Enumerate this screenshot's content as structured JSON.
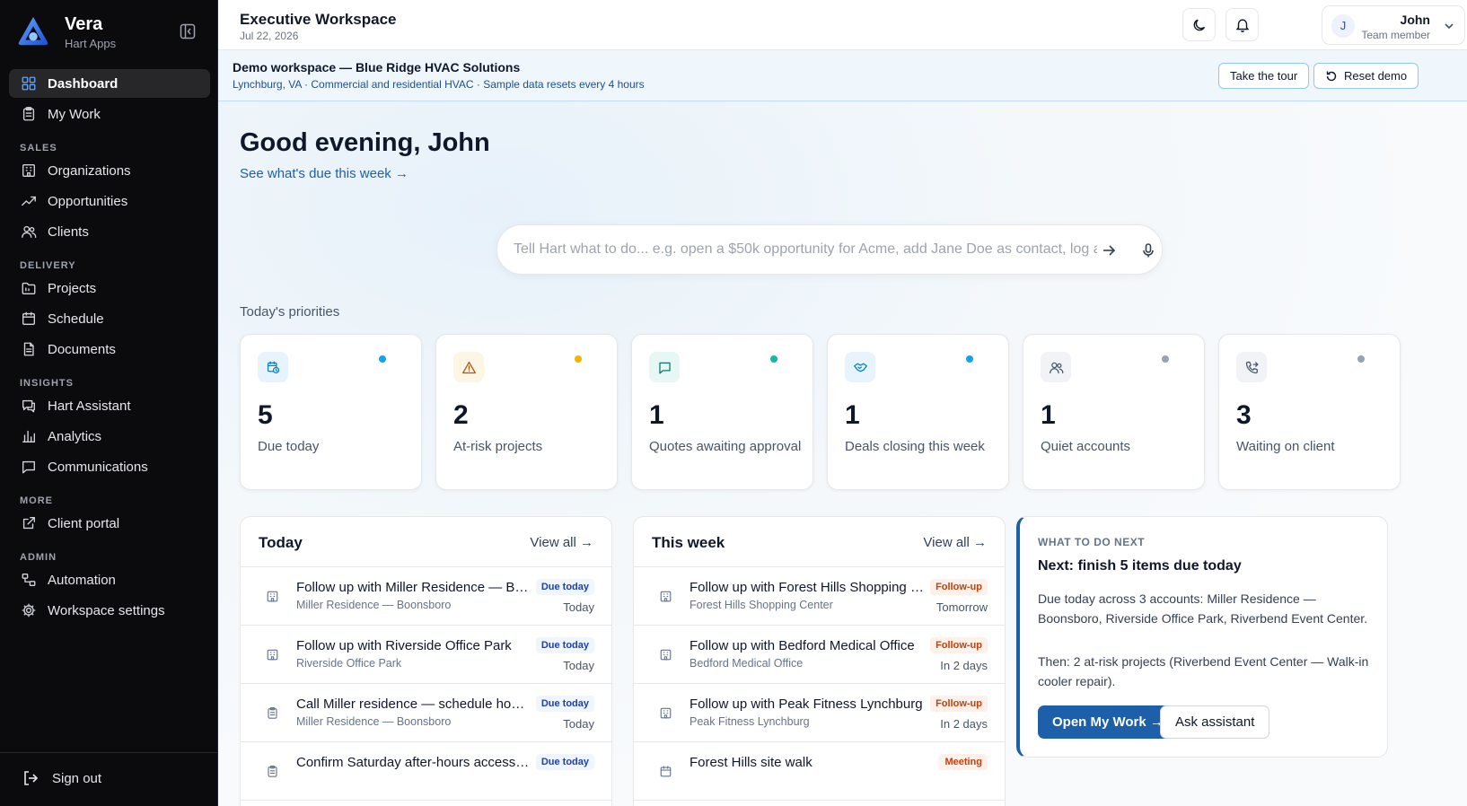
{
  "brand": {
    "name": "Vera",
    "sub": "Hart Apps"
  },
  "nav": {
    "items": [
      {
        "label": "Dashboard",
        "icon": "dashboard-icon",
        "active": true
      },
      {
        "label": "My Work",
        "icon": "clipboard-icon"
      }
    ],
    "sections": [
      {
        "title": "SALES",
        "items": [
          {
            "label": "Organizations",
            "icon": "building-icon"
          },
          {
            "label": "Opportunities",
            "icon": "trending-up-icon"
          },
          {
            "label": "Clients",
            "icon": "users-icon"
          }
        ]
      },
      {
        "title": "DELIVERY",
        "items": [
          {
            "label": "Projects",
            "icon": "folder-icon"
          },
          {
            "label": "Schedule",
            "icon": "calendar-icon"
          },
          {
            "label": "Documents",
            "icon": "document-icon"
          }
        ]
      },
      {
        "title": "INSIGHTS",
        "items": [
          {
            "label": "Hart Assistant",
            "icon": "chat-icon"
          },
          {
            "label": "Analytics",
            "icon": "bar-chart-icon"
          },
          {
            "label": "Communications",
            "icon": "message-icon"
          }
        ]
      },
      {
        "title": "MORE",
        "items": [
          {
            "label": "Client portal",
            "icon": "external-link-icon"
          }
        ]
      },
      {
        "title": "ADMIN",
        "items": [
          {
            "label": "Automation",
            "icon": "workflow-icon"
          },
          {
            "label": "Workspace settings",
            "icon": "gear-icon"
          }
        ]
      }
    ],
    "signout": "Sign out"
  },
  "header": {
    "title": "Executive Workspace",
    "date": "Jul 22, 2026",
    "user": {
      "initial": "J",
      "name": "John",
      "role": "Team member"
    }
  },
  "banner": {
    "title": "Demo workspace — Blue Ridge HVAC Solutions",
    "sub": "Lynchburg, VA · Commercial and residential HVAC · Sample data resets every 4 hours",
    "tour": "Take the tour",
    "reset": "Reset demo"
  },
  "main": {
    "greeting": "Good evening, John",
    "due_link": "See what's due this week →",
    "command_placeholder": "Tell Hart what to do... e.g. open a $50k opportunity for Acme, add Jane Doe as contact, log a call",
    "priorities_label": "Today's priorities",
    "cards": [
      {
        "num": "5",
        "label": "Due today",
        "icon": "calendar-clock-icon",
        "icon_bg": "#e8f4fd",
        "icon_color": "#0284c7",
        "dot": "#0ea5e9"
      },
      {
        "num": "2",
        "label": "At-risk projects",
        "icon": "warning-icon",
        "icon_bg": "#fef6e4",
        "icon_color": "#b45309",
        "dot": "#f5b301"
      },
      {
        "num": "1",
        "label": "Quotes awaiting approval",
        "icon": "message-square-icon",
        "icon_bg": "#e7f7f3",
        "icon_color": "#0f766e",
        "dot": "#14b8a6"
      },
      {
        "num": "1",
        "label": "Deals closing this week",
        "icon": "handshake-icon",
        "icon_bg": "#e8f4fd",
        "icon_color": "#0284c7",
        "dot": "#0ea5e9"
      },
      {
        "num": "1",
        "label": "Quiet accounts",
        "icon": "users-icon",
        "icon_bg": "#f1f3f6",
        "icon_color": "#475569",
        "dot": "#94a3b8"
      },
      {
        "num": "3",
        "label": "Waiting on client",
        "icon": "phone-forward-icon",
        "icon_bg": "#f1f3f6",
        "icon_color": "#475569",
        "dot": "#94a3b8"
      }
    ],
    "today": {
      "title": "Today",
      "view_all": "View all →",
      "rows": [
        {
          "title": "Follow up with Miller Residence — Boonsboro",
          "sub": "Miller Residence — Boonsboro",
          "badge": "Due today",
          "badge_type": "due",
          "when": "Today",
          "icon": "building-icon"
        },
        {
          "title": "Follow up with Riverside Office Park",
          "sub": "Riverside Office Park",
          "badge": "Due today",
          "badge_type": "due",
          "when": "Today",
          "icon": "building-icon"
        },
        {
          "title": "Call Miller residence — schedule home visit",
          "sub": "Miller Residence — Boonsboro",
          "badge": "Due today",
          "badge_type": "due",
          "when": "Today",
          "icon": "clipboard-icon"
        },
        {
          "title": "Confirm Saturday after-hours access with site lead",
          "sub": "",
          "badge": "Due today",
          "badge_type": "due",
          "when": "",
          "icon": "clipboard-icon"
        }
      ]
    },
    "week": {
      "title": "This week",
      "view_all": "View all →",
      "rows": [
        {
          "title": "Follow up with Forest Hills Shopping Center",
          "sub": "Forest Hills Shopping Center",
          "badge": "Follow-up",
          "badge_type": "fu",
          "when": "Tomorrow",
          "icon": "building-icon"
        },
        {
          "title": "Follow up with Bedford Medical Office",
          "sub": "Bedford Medical Office",
          "badge": "Follow-up",
          "badge_type": "fu",
          "when": "In 2 days",
          "icon": "building-icon"
        },
        {
          "title": "Follow up with Peak Fitness Lynchburg",
          "sub": "Peak Fitness Lynchburg",
          "badge": "Follow-up",
          "badge_type": "fu",
          "when": "In 2 days",
          "icon": "building-icon"
        },
        {
          "title": "Forest Hills site walk",
          "sub": "",
          "badge": "Meeting",
          "badge_type": "fu",
          "when": "",
          "icon": "calendar-icon"
        }
      ]
    },
    "next": {
      "kicker": "WHAT TO DO NEXT",
      "title": "Next: finish 5 items due today",
      "p1": "Due today across 3 accounts: Miller Residence — Boonsboro, Riverside Office Park, Riverbend Event Center.",
      "p2": "Then: 2 at-risk projects (Riverbend Event Center — Walk-in cooler repair).",
      "primary": "Open My Work →",
      "secondary": "Ask assistant"
    }
  }
}
